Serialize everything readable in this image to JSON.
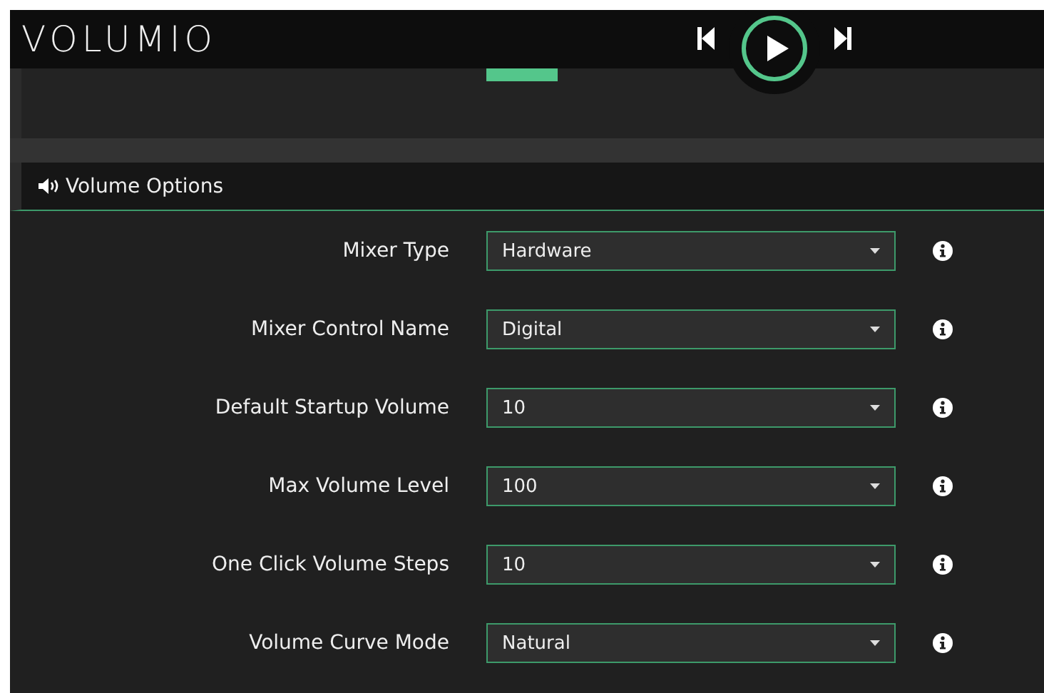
{
  "header": {
    "logo": "VOLUMIO"
  },
  "section": {
    "title": "Volume Options"
  },
  "settings": [
    {
      "label": "Mixer Type",
      "value": "Hardware"
    },
    {
      "label": "Mixer Control Name",
      "value": "Digital"
    },
    {
      "label": "Default Startup Volume",
      "value": "10"
    },
    {
      "label": "Max Volume Level",
      "value": "100"
    },
    {
      "label": "One Click Volume Steps",
      "value": "10"
    },
    {
      "label": "Volume Curve Mode",
      "value": "Natural"
    }
  ]
}
